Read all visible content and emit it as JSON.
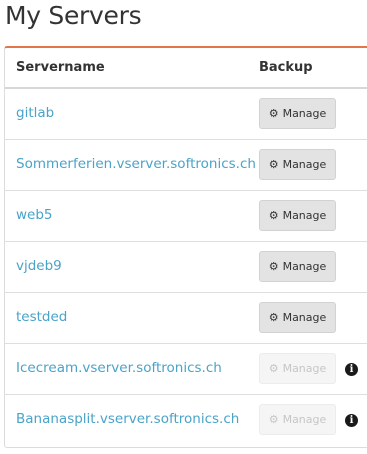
{
  "page": {
    "title": "My Servers"
  },
  "table": {
    "columns": {
      "servername": "Servername",
      "backup": "Backup"
    },
    "rows": [
      {
        "name": "gitlab",
        "action": "Manage",
        "enabled": true,
        "info": false
      },
      {
        "name": "Sommerferien.vserver.softronics.ch",
        "action": "Manage",
        "enabled": true,
        "info": false
      },
      {
        "name": "web5",
        "action": "Manage",
        "enabled": true,
        "info": false
      },
      {
        "name": "vjdeb9",
        "action": "Manage",
        "enabled": true,
        "info": false
      },
      {
        "name": "testded",
        "action": "Manage",
        "enabled": true,
        "info": false
      },
      {
        "name": "Icecream.vserver.softronics.ch",
        "action": "Manage",
        "enabled": false,
        "info": true
      },
      {
        "name": "Bananasplit.vserver.softronics.ch",
        "action": "Manage",
        "enabled": false,
        "info": true
      }
    ]
  },
  "icons": {
    "manage": "gear-icon",
    "info": "info-circle-icon"
  },
  "colors": {
    "accent": "#e0764a",
    "link": "#4aa3c8",
    "button_bg": "#e3e3e3",
    "button_disabled_text": "#c6c6c6"
  }
}
